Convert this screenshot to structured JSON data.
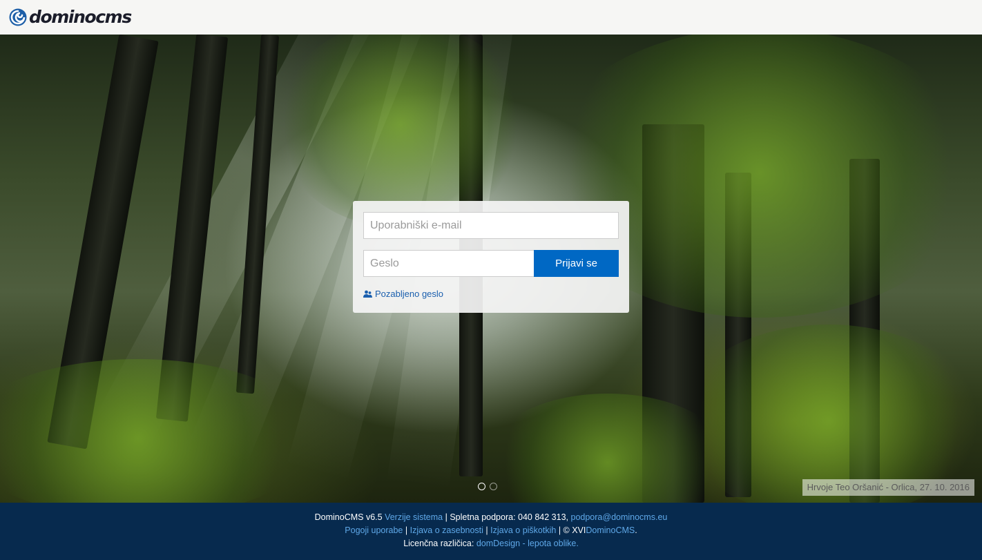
{
  "header": {
    "logo_text": "dominocms"
  },
  "login": {
    "email_placeholder": "Uporabniški e-mail",
    "password_placeholder": "Geslo",
    "submit_label": "Prijavi se",
    "forgot_label": "Pozabljeno geslo"
  },
  "slider": {
    "active_index": 1,
    "count": 2,
    "photo_credit": "Hrvoje Teo Oršanić - Orlica, 27. 10. 2016"
  },
  "footer": {
    "line1": {
      "product": "DominoCMS v6.5",
      "versions_link": "Verzije sistema",
      "support_text": "| Spletna podpora: 040 842 313,",
      "support_email": "podpora@dominocms.eu"
    },
    "line2": {
      "terms_link": "Pogoji uporabe",
      "sep1": "|",
      "privacy_link": "Izjava o zasebnosti",
      "sep2": "|",
      "cookies_link": "Izjava o piškotkih",
      "copyright_text": "| © XVI",
      "brand_link": "DominoCMS",
      "end": "."
    },
    "line3": {
      "license_label": "Licenčna različica:",
      "license_link": "domDesign - lepota oblike."
    }
  },
  "colors": {
    "accent": "#0068c4",
    "footer_bg": "#072a4e",
    "link": "#5fa8e8"
  }
}
